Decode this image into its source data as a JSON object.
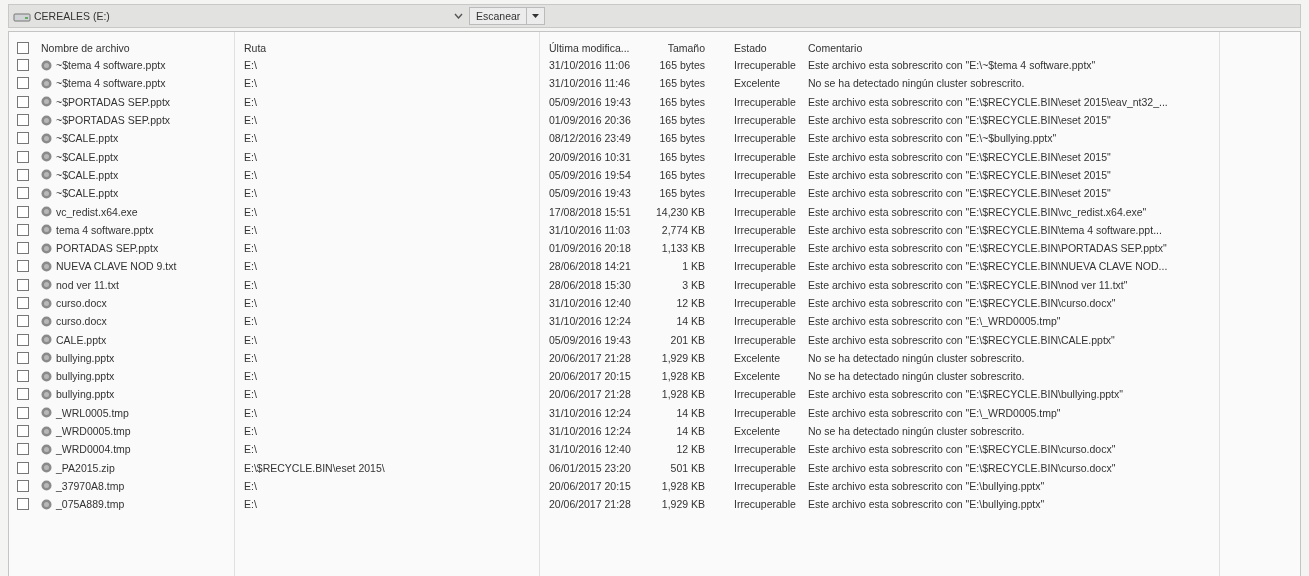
{
  "toolbar": {
    "drive": "CEREALES (E:)",
    "scan_button": "Escanear"
  },
  "table": {
    "select_all_checked": false,
    "columns": [
      "Nombre de archivo",
      "Ruta",
      "Última modifica...",
      "Tamaño",
      "Estado",
      "Comentario"
    ],
    "rows": [
      {
        "checked": false,
        "name": "~$tema 4 software.pptx",
        "path": "E:\\",
        "modified": "31/10/2016 11:06",
        "size": "165 bytes",
        "status": "Irrecuperable",
        "comment": "Este archivo esta sobrescrito con \"E:\\~$tema 4 software.pptx\""
      },
      {
        "checked": false,
        "name": "~$tema 4 software.pptx",
        "path": "E:\\",
        "modified": "31/10/2016 11:46",
        "size": "165 bytes",
        "status": "Excelente",
        "comment": "No se ha detectado ningún cluster sobrescrito."
      },
      {
        "checked": false,
        "name": "~$PORTADAS SEP.pptx",
        "path": "E:\\",
        "modified": "05/09/2016 19:43",
        "size": "165 bytes",
        "status": "Irrecuperable",
        "comment": "Este archivo esta sobrescrito con \"E:\\$RECYCLE.BIN\\eset 2015\\eav_nt32_..."
      },
      {
        "checked": false,
        "name": "~$PORTADAS SEP.pptx",
        "path": "E:\\",
        "modified": "01/09/2016 20:36",
        "size": "165 bytes",
        "status": "Irrecuperable",
        "comment": "Este archivo esta sobrescrito con \"E:\\$RECYCLE.BIN\\eset 2015\""
      },
      {
        "checked": false,
        "name": "~$CALE.pptx",
        "path": "E:\\",
        "modified": "08/12/2016 23:49",
        "size": "165 bytes",
        "status": "Irrecuperable",
        "comment": "Este archivo esta sobrescrito con \"E:\\~$bullying.pptx\""
      },
      {
        "checked": false,
        "name": "~$CALE.pptx",
        "path": "E:\\",
        "modified": "20/09/2016 10:31",
        "size": "165 bytes",
        "status": "Irrecuperable",
        "comment": "Este archivo esta sobrescrito con \"E:\\$RECYCLE.BIN\\eset 2015\""
      },
      {
        "checked": false,
        "name": "~$CALE.pptx",
        "path": "E:\\",
        "modified": "05/09/2016 19:54",
        "size": "165 bytes",
        "status": "Irrecuperable",
        "comment": "Este archivo esta sobrescrito con \"E:\\$RECYCLE.BIN\\eset 2015\""
      },
      {
        "checked": false,
        "name": "~$CALE.pptx",
        "path": "E:\\",
        "modified": "05/09/2016 19:43",
        "size": "165 bytes",
        "status": "Irrecuperable",
        "comment": "Este archivo esta sobrescrito con \"E:\\$RECYCLE.BIN\\eset 2015\""
      },
      {
        "checked": false,
        "name": "vc_redist.x64.exe",
        "path": "E:\\",
        "modified": "17/08/2018 15:51",
        "size": "14,230 KB",
        "status": "Irrecuperable",
        "comment": "Este archivo esta sobrescrito con \"E:\\$RECYCLE.BIN\\vc_redist.x64.exe\""
      },
      {
        "checked": false,
        "name": "tema 4 software.pptx",
        "path": "E:\\",
        "modified": "31/10/2016 11:03",
        "size": "2,774 KB",
        "status": "Irrecuperable",
        "comment": "Este archivo esta sobrescrito con \"E:\\$RECYCLE.BIN\\tema 4 software.ppt..."
      },
      {
        "checked": false,
        "name": "PORTADAS SEP.pptx",
        "path": "E:\\",
        "modified": "01/09/2016 20:18",
        "size": "1,133 KB",
        "status": "Irrecuperable",
        "comment": "Este archivo esta sobrescrito con \"E:\\$RECYCLE.BIN\\PORTADAS SEP.pptx\""
      },
      {
        "checked": false,
        "name": "NUEVA CLAVE NOD 9.txt",
        "path": "E:\\",
        "modified": "28/06/2018 14:21",
        "size": "1 KB",
        "status": "Irrecuperable",
        "comment": "Este archivo esta sobrescrito con \"E:\\$RECYCLE.BIN\\NUEVA CLAVE NOD..."
      },
      {
        "checked": false,
        "name": "nod ver 11.txt",
        "path": "E:\\",
        "modified": "28/06/2018 15:30",
        "size": "3 KB",
        "status": "Irrecuperable",
        "comment": "Este archivo esta sobrescrito con \"E:\\$RECYCLE.BIN\\nod ver 11.txt\""
      },
      {
        "checked": false,
        "name": "curso.docx",
        "path": "E:\\",
        "modified": "31/10/2016 12:40",
        "size": "12 KB",
        "status": "Irrecuperable",
        "comment": "Este archivo esta sobrescrito con \"E:\\$RECYCLE.BIN\\curso.docx\""
      },
      {
        "checked": false,
        "name": "curso.docx",
        "path": "E:\\",
        "modified": "31/10/2016 12:24",
        "size": "14 KB",
        "status": "Irrecuperable",
        "comment": "Este archivo esta sobrescrito con \"E:\\_WRD0005.tmp\""
      },
      {
        "checked": false,
        "name": "CALE.pptx",
        "path": "E:\\",
        "modified": "05/09/2016 19:43",
        "size": "201 KB",
        "status": "Irrecuperable",
        "comment": "Este archivo esta sobrescrito con \"E:\\$RECYCLE.BIN\\CALE.pptx\""
      },
      {
        "checked": false,
        "name": "bullying.pptx",
        "path": "E:\\",
        "modified": "20/06/2017 21:28",
        "size": "1,929 KB",
        "status": "Excelente",
        "comment": "No se ha detectado ningún cluster sobrescrito."
      },
      {
        "checked": false,
        "name": "bullying.pptx",
        "path": "E:\\",
        "modified": "20/06/2017 20:15",
        "size": "1,928 KB",
        "status": "Excelente",
        "comment": "No se ha detectado ningún cluster sobrescrito."
      },
      {
        "checked": false,
        "name": "bullying.pptx",
        "path": "E:\\",
        "modified": "20/06/2017 21:28",
        "size": "1,928 KB",
        "status": "Irrecuperable",
        "comment": "Este archivo esta sobrescrito con \"E:\\$RECYCLE.BIN\\bullying.pptx\""
      },
      {
        "checked": false,
        "name": "_WRL0005.tmp",
        "path": "E:\\",
        "modified": "31/10/2016 12:24",
        "size": "14 KB",
        "status": "Irrecuperable",
        "comment": "Este archivo esta sobrescrito con \"E:\\_WRD0005.tmp\""
      },
      {
        "checked": false,
        "name": "_WRD0005.tmp",
        "path": "E:\\",
        "modified": "31/10/2016 12:24",
        "size": "14 KB",
        "status": "Excelente",
        "comment": "No se ha detectado ningún cluster sobrescrito."
      },
      {
        "checked": false,
        "name": "_WRD0004.tmp",
        "path": "E:\\",
        "modified": "31/10/2016 12:40",
        "size": "12 KB",
        "status": "Irrecuperable",
        "comment": "Este archivo esta sobrescrito con \"E:\\$RECYCLE.BIN\\curso.docx\""
      },
      {
        "checked": false,
        "name": "_PA2015.zip",
        "path": "E:\\$RECYCLE.BIN\\eset 2015\\",
        "modified": "06/01/2015 23:20",
        "size": "501 KB",
        "status": "Irrecuperable",
        "comment": "Este archivo esta sobrescrito con \"E:\\$RECYCLE.BIN\\curso.docx\""
      },
      {
        "checked": false,
        "name": "_37970A8.tmp",
        "path": "E:\\",
        "modified": "20/06/2017 20:15",
        "size": "1,928 KB",
        "status": "Irrecuperable",
        "comment": "Este archivo esta sobrescrito con \"E:\\bullying.pptx\""
      },
      {
        "checked": false,
        "name": "_075A889.tmp",
        "path": "E:\\",
        "modified": "20/06/2017 21:28",
        "size": "1,929 KB",
        "status": "Irrecuperable",
        "comment": "Este archivo esta sobrescrito con \"E:\\bullying.pptx\""
      }
    ]
  }
}
